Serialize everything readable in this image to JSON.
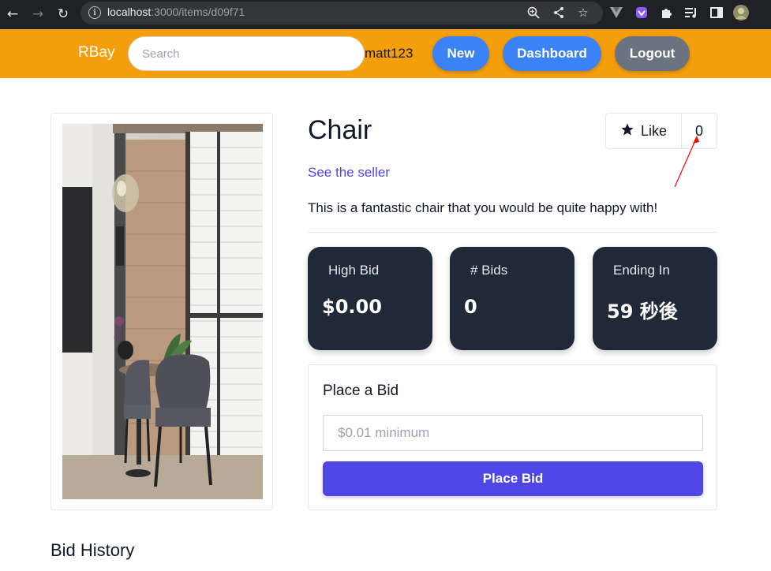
{
  "browser": {
    "url_host": "localhost",
    "url_rest": ":3000/items/d09f71"
  },
  "navbar": {
    "brand": "RBay",
    "search_placeholder": "Search",
    "username": "matt123",
    "buttons": {
      "new": "New",
      "dashboard": "Dashboard",
      "logout": "Logout"
    },
    "colors": {
      "bar": "#f59e0b",
      "primary": "#3b82f6",
      "secondary": "#6b7280"
    }
  },
  "item": {
    "title": "Chair",
    "seller_link": "See the seller",
    "description": "This is a fantastic chair that you would be quite happy with!",
    "like": {
      "label": "Like",
      "count": "0"
    }
  },
  "stats": [
    {
      "label": "High Bid",
      "value": "$0.00"
    },
    {
      "label": "# Bids",
      "value": "0"
    },
    {
      "label": "Ending In",
      "value": "59 秒後"
    }
  ],
  "bid_form": {
    "heading": "Place a Bid",
    "placeholder": "$0.01 minimum",
    "button": "Place Bid",
    "button_color": "#4f46e5"
  },
  "bid_history": {
    "heading": "Bid History"
  }
}
